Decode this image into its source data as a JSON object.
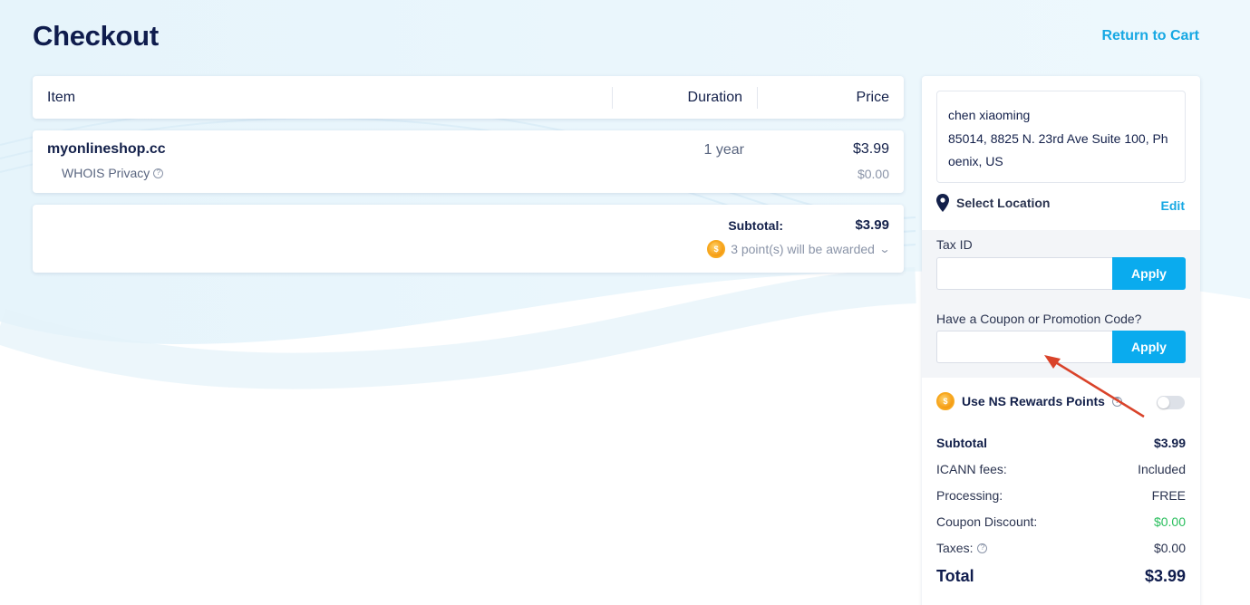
{
  "header": {
    "title": "Checkout",
    "return_link": "Return to Cart"
  },
  "table": {
    "columns": [
      "Item",
      "Duration",
      "Price"
    ]
  },
  "item": {
    "name": "myonlineshop.cc",
    "duration": "1 year",
    "price": "$3.99",
    "addon_label": "WHOIS Privacy",
    "addon_price": "$0.00"
  },
  "subtotal_card": {
    "label": "Subtotal:",
    "value": "$3.99",
    "points_text": "3 point(s) will be awarded"
  },
  "sidebar": {
    "address_lines": [
      "chen xiaoming",
      "85014, 8825 N. 23rd Ave Suite 100, Ph",
      "oenix, US"
    ],
    "select_location": "Select Location",
    "edit": "Edit",
    "tax_label": "Tax ID",
    "tax_placeholder": "",
    "apply": "Apply",
    "coupon_label": "Have a Coupon or Promotion Code?",
    "coupon_placeholder": "",
    "rewards_label": "Use NS Rewards Points",
    "rewards_enabled": false,
    "summary": {
      "subtotal_label": "Subtotal",
      "subtotal_value": "$3.99",
      "icann_label": "ICANN fees:",
      "icann_value": "Included",
      "processing_label": "Processing:",
      "processing_value": "FREE",
      "coupon_label": "Coupon Discount:",
      "coupon_value": "$0.00",
      "taxes_label": "Taxes:",
      "taxes_value": "$0.00",
      "total_label": "Total",
      "total_value": "$3.99"
    }
  },
  "colors": {
    "accent": "#17a8e3",
    "button": "#0aabee",
    "title": "#0f1c4d",
    "green": "#2bbf5e",
    "annotation_arrow": "#d9432a"
  },
  "icons": [
    "question-icon",
    "coin-icon",
    "chevron-down-icon",
    "location-pin-icon"
  ]
}
